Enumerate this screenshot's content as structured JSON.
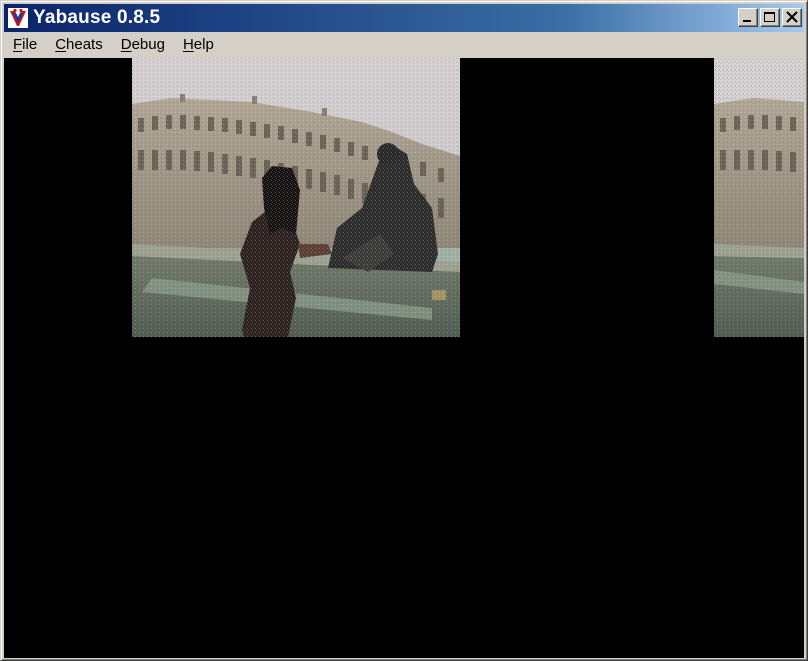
{
  "window": {
    "title": "Yabause 0.8.5",
    "icon": "yabause-app-icon"
  },
  "title_buttons": [
    {
      "name": "minimize",
      "icon": "minimize-icon"
    },
    {
      "name": "maximize",
      "icon": "maximize-icon"
    },
    {
      "name": "close",
      "icon": "close-icon"
    }
  ],
  "menu": [
    {
      "first": "F",
      "rest": "ile"
    },
    {
      "first": "C",
      "rest": "heats"
    },
    {
      "first": "D",
      "rest": "ebug"
    },
    {
      "first": "H",
      "rest": "elp"
    }
  ],
  "colors": {
    "titlebar_start": "#0a246a",
    "titlebar_end": "#a6caf0",
    "chrome": "#d4d0c8",
    "screen": "#000000"
  },
  "emulator_screen": {
    "content": "photo-of-palace-with-two-people-and-statue",
    "layers": [
      "main-photo-layer",
      "edge-photo-layer"
    ]
  }
}
